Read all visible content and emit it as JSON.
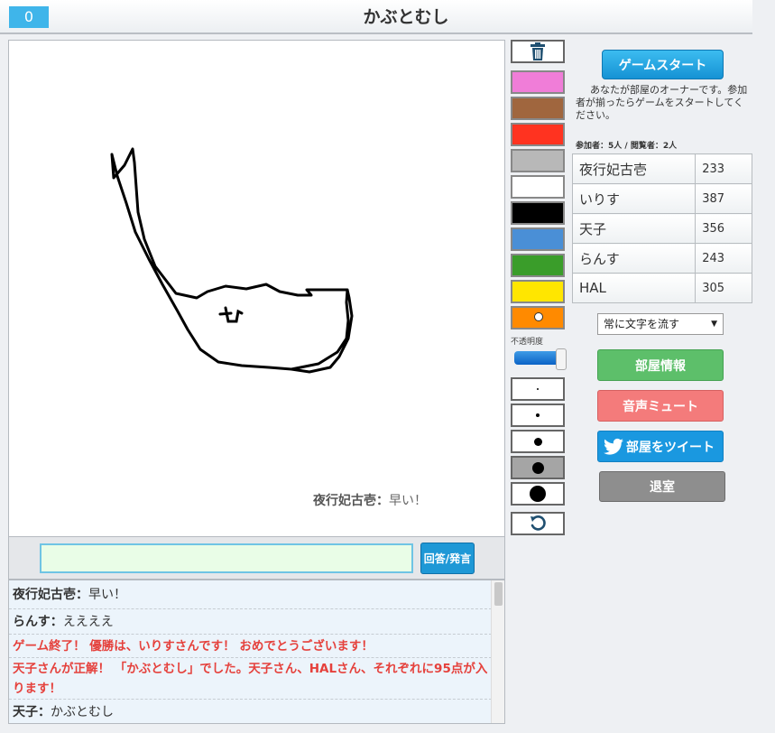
{
  "header": {
    "counter": "0",
    "title": "かぶとむし"
  },
  "canvas": {
    "comment_name": "夜行妃古壱：",
    "comment_text": "早い！"
  },
  "tools": {
    "trash_icon": "trash-icon",
    "colors": [
      "#f07dd8",
      "#a0663e",
      "#ff3320",
      "#b8b8b8",
      "#ffffff",
      "#000000",
      "#4a8fd6",
      "#3a9d2a",
      "#ffe600",
      "#ff8a00"
    ],
    "selected_color_index": 9,
    "opacity_label": "不透明度",
    "opacity_value": 1.0,
    "brush_sizes": [
      2,
      4,
      9,
      13,
      18
    ],
    "selected_brush_index": 3,
    "undo_icon": "undo-icon"
  },
  "answer": {
    "value": "",
    "button_label": "回答/発言"
  },
  "chat": [
    {
      "name": "夜行妃古壱：",
      "text": "早い！",
      "system": false
    },
    {
      "name": "らんす：",
      "text": "ええええ",
      "system": false
    },
    {
      "name": "",
      "text": "ゲーム終了！ 優勝は、いりすさんです！ おめでとうございます！",
      "system": true
    },
    {
      "name": "",
      "text": "天子さんが正解！ 「かぶとむし」でした。天子さん、HALさん、それぞれに95点が入ります！",
      "system": true
    },
    {
      "name": "天子：",
      "text": "かぶとむし",
      "system": false
    }
  ],
  "right": {
    "start_label": "ゲームスタート",
    "owner_message": "あなたが部屋のオーナーです。参加者が揃ったらゲームをスタートしてください。",
    "participant_summary": "参加者：5人 / 閲覧者：2人",
    "players": [
      {
        "name": "夜行妃古壱",
        "score": "233"
      },
      {
        "name": "いりす",
        "score": "387"
      },
      {
        "name": "天子",
        "score": "356"
      },
      {
        "name": "らんす",
        "score": "243"
      },
      {
        "name": "HAL",
        "score": "305"
      }
    ],
    "flow_select": "常に文字を流す",
    "room_info_label": "部屋情報",
    "mute_label": "音声ミュート",
    "tweet_label": "部屋をツイート",
    "leave_label": "退室"
  }
}
